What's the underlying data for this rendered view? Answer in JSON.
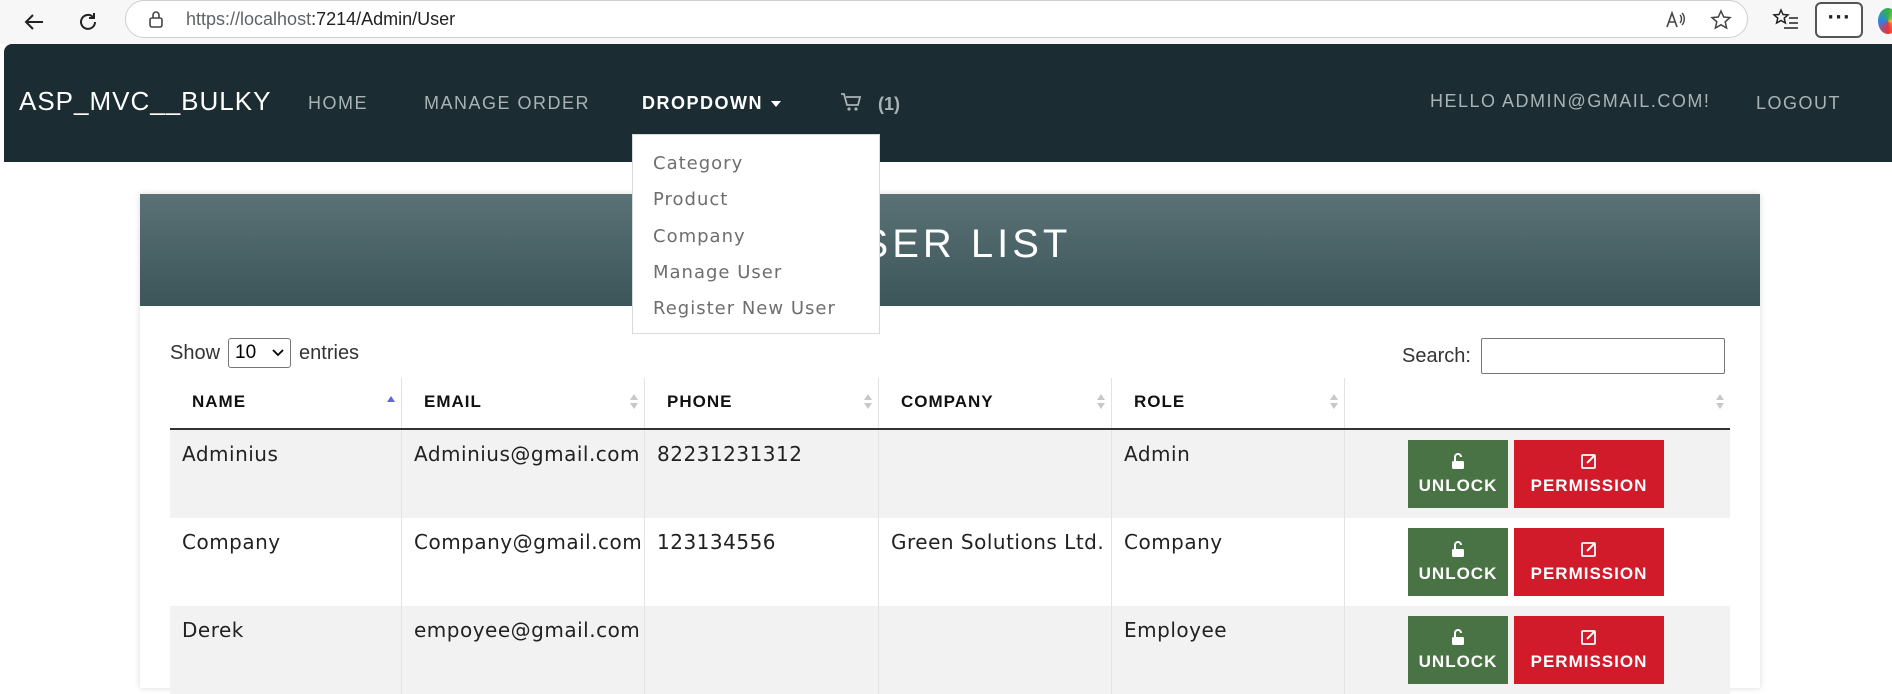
{
  "browser": {
    "url_host": "https://localhost",
    "url_rest": ":7214/Admin/User"
  },
  "navbar": {
    "brand": "ASP_MVC__BULKY",
    "links": [
      "HOME",
      "MANAGE ORDER",
      "DROPDOWN"
    ],
    "cart_count": "(1)",
    "greeting": "HELLO ADMIN@GMAIL.COM!",
    "logout": "LOGOUT"
  },
  "dropdown": {
    "items": [
      "Category",
      "Product",
      "Company",
      "Manage User",
      "Register New User"
    ]
  },
  "card": {
    "title": "USER LIST"
  },
  "table_controls": {
    "show_label": "Show",
    "entries_value": "10",
    "entries_label": "entries",
    "search_label": "Search:"
  },
  "table": {
    "columns": [
      "NAME",
      "EMAIL",
      "PHONE",
      "COMPANY",
      "ROLE",
      ""
    ],
    "rows": [
      {
        "name": "Adminius",
        "email": "Adminius@gmail.com",
        "phone": "82231231312",
        "company": "",
        "role": "Admin"
      },
      {
        "name": "Company",
        "email": "Company@gmail.com",
        "phone": "123134556",
        "company": "Green Solutions Ltd.",
        "role": "Company"
      },
      {
        "name": "Derek",
        "email": "empoyee@gmail.com",
        "phone": "",
        "company": "",
        "role": "Employee"
      }
    ],
    "unlock_label": "UNLOCK",
    "permission_label": "PERMISSION"
  },
  "colors": {
    "navbar_bg": "#1b2d33",
    "header_gradient_top": "#5a7276",
    "unlock_btn": "#4a7345",
    "permission_btn": "#d11a2a"
  }
}
